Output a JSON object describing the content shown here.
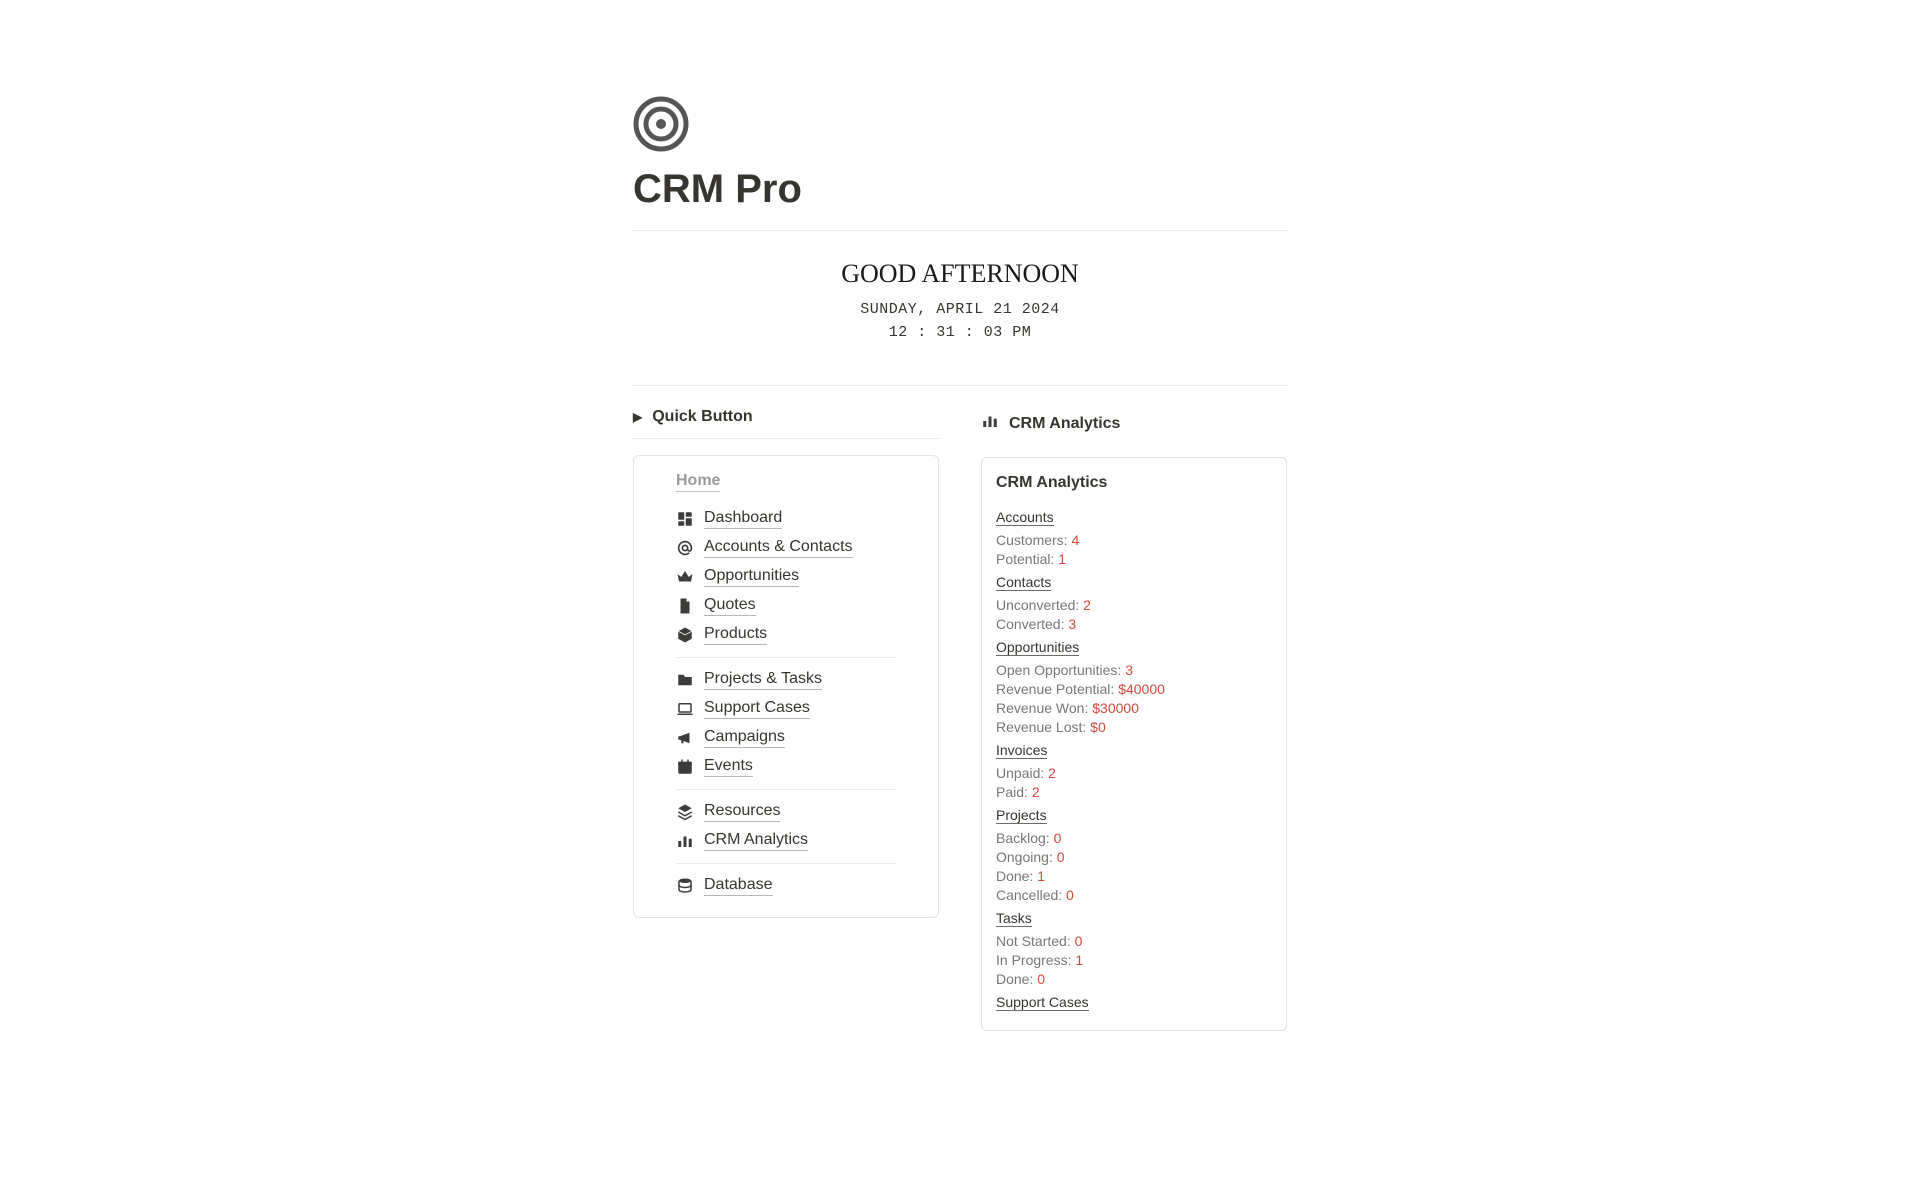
{
  "header": {
    "title": "CRM Pro"
  },
  "greeting": {
    "text": "GOOD AFTERNOON",
    "date": "SUNDAY, APRIL 21 2024",
    "time": "12 : 31 : 03 PM"
  },
  "quickButton": {
    "label": "Quick Button"
  },
  "nav": {
    "home_label": "Home",
    "group1": {
      "dashboard": "Dashboard",
      "accounts": "Accounts & Contacts",
      "opportunities": "Opportunities",
      "quotes": "Quotes",
      "products": "Products"
    },
    "group2": {
      "projects": "Projects & Tasks",
      "support": "Support Cases",
      "campaigns": "Campaigns",
      "events": "Events"
    },
    "group3": {
      "resources": "Resources",
      "analytics": "CRM Analytics"
    },
    "group4": {
      "database": "Database"
    }
  },
  "analytics": {
    "header": "CRM Analytics",
    "card_title": "CRM Analytics",
    "sections": {
      "accounts": {
        "title": "Accounts",
        "customers_label": "Customers: ",
        "customers_val": "4",
        "potential_label": "Potential: ",
        "potential_val": "1"
      },
      "contacts": {
        "title": "Contacts",
        "unconverted_label": "Unconverted: ",
        "unconverted_val": "2",
        "converted_label": "Converted: ",
        "converted_val": "3"
      },
      "opportunities": {
        "title": "Opportunities",
        "open_label": "Open Opportunities: ",
        "open_val": "3",
        "rev_pot_label": "Revenue Potential: ",
        "rev_pot_val": "$40000",
        "rev_won_label": "Revenue Won: ",
        "rev_won_val": "$30000",
        "rev_lost_label": "Revenue Lost: ",
        "rev_lost_val": "$0"
      },
      "invoices": {
        "title": "Invoices",
        "unpaid_label": "Unpaid: ",
        "unpaid_val": "2",
        "paid_label": "Paid: ",
        "paid_val": "2"
      },
      "projects": {
        "title": "Projects",
        "backlog_label": "Backlog: ",
        "backlog_val": "0",
        "ongoing_label": "Ongoing: ",
        "ongoing_val": "0",
        "done_label": "Done: ",
        "done_val": "1",
        "cancelled_label": "Cancelled: ",
        "cancelled_val": "0"
      },
      "tasks": {
        "title": "Tasks",
        "notstarted_label": "Not Started: ",
        "notstarted_val": "0",
        "inprogress_label": "In Progress: ",
        "inprogress_val": "1",
        "done_label": "Done: ",
        "done_val": "0"
      },
      "support": {
        "title": "Support Cases"
      }
    }
  }
}
